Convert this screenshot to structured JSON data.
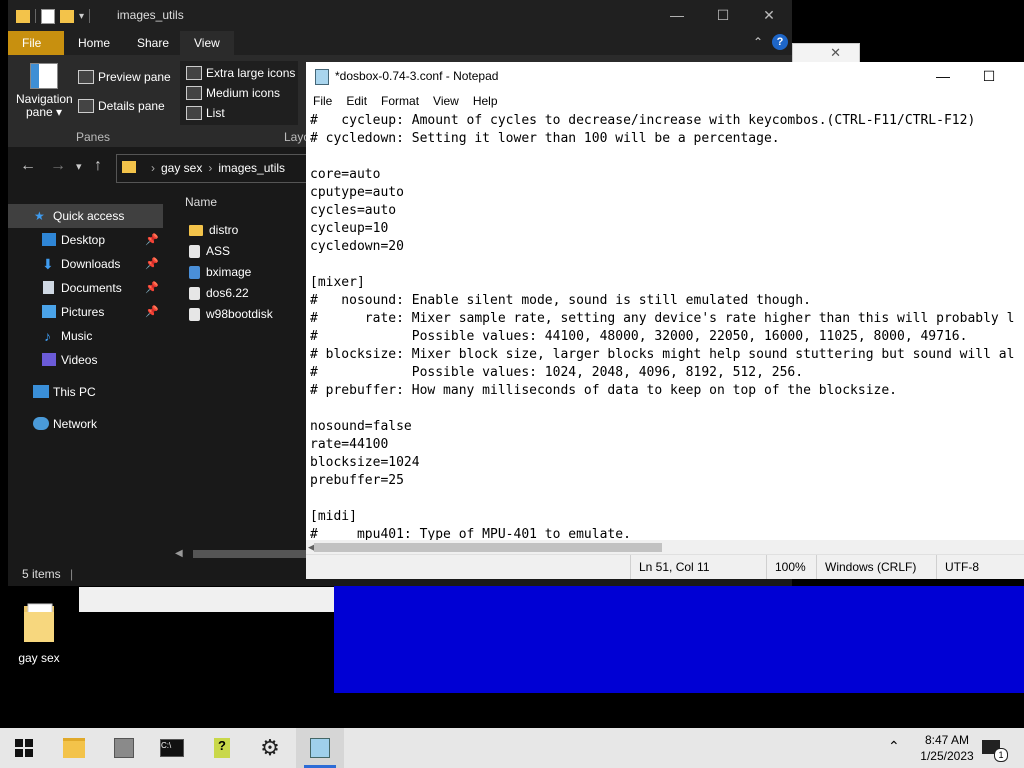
{
  "desktop": {
    "folder_label": "gay sex"
  },
  "explorer": {
    "title": "images_utils",
    "ribbon_tabs": [
      "File",
      "Home",
      "Share",
      "View"
    ],
    "ribbon": {
      "navigation_pane": "Navigation pane ▾",
      "preview_pane": "Preview pane",
      "details_pane": "Details pane",
      "panes_group": "Panes",
      "layout_group": "Layo",
      "layout_options": [
        "Extra large icons",
        "Medium icons",
        "List"
      ]
    },
    "breadcrumb": [
      "gay sex",
      "images_utils"
    ],
    "nav_tree": {
      "quick_access": "Quick access",
      "pinned": [
        "Desktop",
        "Downloads",
        "Documents",
        "Pictures"
      ],
      "unpinned": [
        "Music",
        "Videos"
      ],
      "this_pc": "This PC",
      "network": "Network"
    },
    "column_name": "Name",
    "files": [
      {
        "name": "distro",
        "type": "folder"
      },
      {
        "name": "ASS",
        "type": "file"
      },
      {
        "name": "bximage",
        "type": "file"
      },
      {
        "name": "dos6.22",
        "type": "file"
      },
      {
        "name": "w98bootdisk",
        "type": "file"
      }
    ],
    "status": "5 items"
  },
  "notepad": {
    "title": "*dosbox-0.74-3.conf - Notepad",
    "menu": [
      "File",
      "Edit",
      "Format",
      "View",
      "Help"
    ],
    "text": "#   cycleup: Amount of cycles to decrease/increase with keycombos.(CTRL-F11/CTRL-F12)\n# cycledown: Setting it lower than 100 will be a percentage.\n\ncore=auto\ncputype=auto\ncycles=auto\ncycleup=10\ncycledown=20\n\n[mixer]\n#   nosound: Enable silent mode, sound is still emulated though.\n#      rate: Mixer sample rate, setting any device's rate higher than this will probably l\n#            Possible values: 44100, 48000, 32000, 22050, 16000, 11025, 8000, 49716.\n# blocksize: Mixer block size, larger blocks might help sound stuttering but sound will al\n#            Possible values: 1024, 2048, 4096, 8192, 512, 256.\n# prebuffer: How many milliseconds of data to keep on top of the blocksize.\n\nnosound=false\nrate=44100\nblocksize=1024\nprebuffer=25\n\n[midi]\n#     mpu401: Type of MPU-401 to emulate.",
    "status": {
      "position": "Ln 51, Col 11",
      "zoom": "100%",
      "line_ending": "Windows (CRLF)",
      "encoding": "UTF-8"
    }
  },
  "taskbar": {
    "time": "8:47 AM",
    "date": "1/25/2023",
    "notification_count": "1"
  }
}
